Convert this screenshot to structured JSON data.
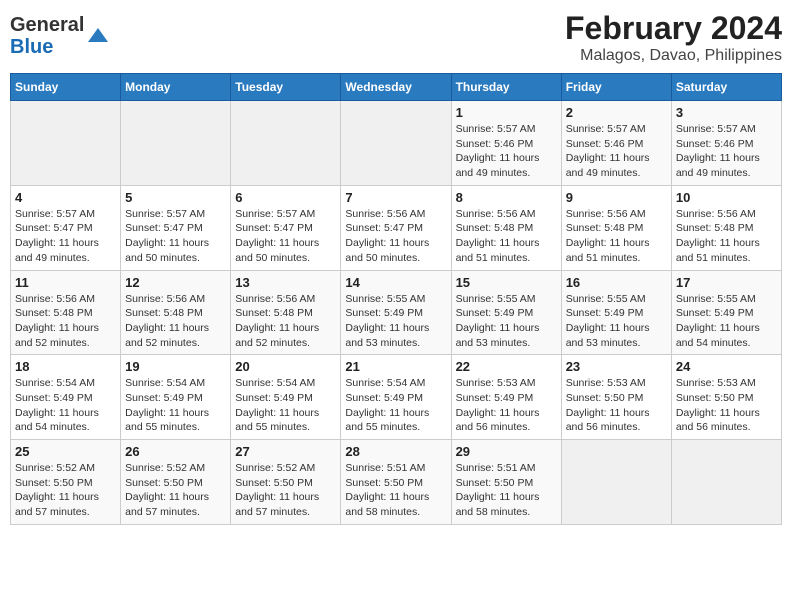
{
  "logo": {
    "text_general": "General",
    "text_blue": "Blue"
  },
  "title": "February 2024",
  "subtitle": "Malagos, Davao, Philippines",
  "days_of_week": [
    "Sunday",
    "Monday",
    "Tuesday",
    "Wednesday",
    "Thursday",
    "Friday",
    "Saturday"
  ],
  "weeks": [
    [
      {
        "day": "",
        "info": ""
      },
      {
        "day": "",
        "info": ""
      },
      {
        "day": "",
        "info": ""
      },
      {
        "day": "",
        "info": ""
      },
      {
        "day": "1",
        "sunrise": "5:57 AM",
        "sunset": "5:46 PM",
        "daylight": "11 hours and 49 minutes."
      },
      {
        "day": "2",
        "sunrise": "5:57 AM",
        "sunset": "5:46 PM",
        "daylight": "11 hours and 49 minutes."
      },
      {
        "day": "3",
        "sunrise": "5:57 AM",
        "sunset": "5:46 PM",
        "daylight": "11 hours and 49 minutes."
      }
    ],
    [
      {
        "day": "4",
        "sunrise": "5:57 AM",
        "sunset": "5:47 PM",
        "daylight": "11 hours and 49 minutes."
      },
      {
        "day": "5",
        "sunrise": "5:57 AM",
        "sunset": "5:47 PM",
        "daylight": "11 hours and 50 minutes."
      },
      {
        "day": "6",
        "sunrise": "5:57 AM",
        "sunset": "5:47 PM",
        "daylight": "11 hours and 50 minutes."
      },
      {
        "day": "7",
        "sunrise": "5:56 AM",
        "sunset": "5:47 PM",
        "daylight": "11 hours and 50 minutes."
      },
      {
        "day": "8",
        "sunrise": "5:56 AM",
        "sunset": "5:48 PM",
        "daylight": "11 hours and 51 minutes."
      },
      {
        "day": "9",
        "sunrise": "5:56 AM",
        "sunset": "5:48 PM",
        "daylight": "11 hours and 51 minutes."
      },
      {
        "day": "10",
        "sunrise": "5:56 AM",
        "sunset": "5:48 PM",
        "daylight": "11 hours and 51 minutes."
      }
    ],
    [
      {
        "day": "11",
        "sunrise": "5:56 AM",
        "sunset": "5:48 PM",
        "daylight": "11 hours and 52 minutes."
      },
      {
        "day": "12",
        "sunrise": "5:56 AM",
        "sunset": "5:48 PM",
        "daylight": "11 hours and 52 minutes."
      },
      {
        "day": "13",
        "sunrise": "5:56 AM",
        "sunset": "5:48 PM",
        "daylight": "11 hours and 52 minutes."
      },
      {
        "day": "14",
        "sunrise": "5:55 AM",
        "sunset": "5:49 PM",
        "daylight": "11 hours and 53 minutes."
      },
      {
        "day": "15",
        "sunrise": "5:55 AM",
        "sunset": "5:49 PM",
        "daylight": "11 hours and 53 minutes."
      },
      {
        "day": "16",
        "sunrise": "5:55 AM",
        "sunset": "5:49 PM",
        "daylight": "11 hours and 53 minutes."
      },
      {
        "day": "17",
        "sunrise": "5:55 AM",
        "sunset": "5:49 PM",
        "daylight": "11 hours and 54 minutes."
      }
    ],
    [
      {
        "day": "18",
        "sunrise": "5:54 AM",
        "sunset": "5:49 PM",
        "daylight": "11 hours and 54 minutes."
      },
      {
        "day": "19",
        "sunrise": "5:54 AM",
        "sunset": "5:49 PM",
        "daylight": "11 hours and 55 minutes."
      },
      {
        "day": "20",
        "sunrise": "5:54 AM",
        "sunset": "5:49 PM",
        "daylight": "11 hours and 55 minutes."
      },
      {
        "day": "21",
        "sunrise": "5:54 AM",
        "sunset": "5:49 PM",
        "daylight": "11 hours and 55 minutes."
      },
      {
        "day": "22",
        "sunrise": "5:53 AM",
        "sunset": "5:49 PM",
        "daylight": "11 hours and 56 minutes."
      },
      {
        "day": "23",
        "sunrise": "5:53 AM",
        "sunset": "5:50 PM",
        "daylight": "11 hours and 56 minutes."
      },
      {
        "day": "24",
        "sunrise": "5:53 AM",
        "sunset": "5:50 PM",
        "daylight": "11 hours and 56 minutes."
      }
    ],
    [
      {
        "day": "25",
        "sunrise": "5:52 AM",
        "sunset": "5:50 PM",
        "daylight": "11 hours and 57 minutes."
      },
      {
        "day": "26",
        "sunrise": "5:52 AM",
        "sunset": "5:50 PM",
        "daylight": "11 hours and 57 minutes."
      },
      {
        "day": "27",
        "sunrise": "5:52 AM",
        "sunset": "5:50 PM",
        "daylight": "11 hours and 57 minutes."
      },
      {
        "day": "28",
        "sunrise": "5:51 AM",
        "sunset": "5:50 PM",
        "daylight": "11 hours and 58 minutes."
      },
      {
        "day": "29",
        "sunrise": "5:51 AM",
        "sunset": "5:50 PM",
        "daylight": "11 hours and 58 minutes."
      },
      {
        "day": "",
        "info": ""
      },
      {
        "day": "",
        "info": ""
      }
    ]
  ],
  "labels": {
    "sunrise_prefix": "Sunrise: ",
    "sunset_prefix": "Sunset: ",
    "daylight_prefix": "Daylight: "
  }
}
